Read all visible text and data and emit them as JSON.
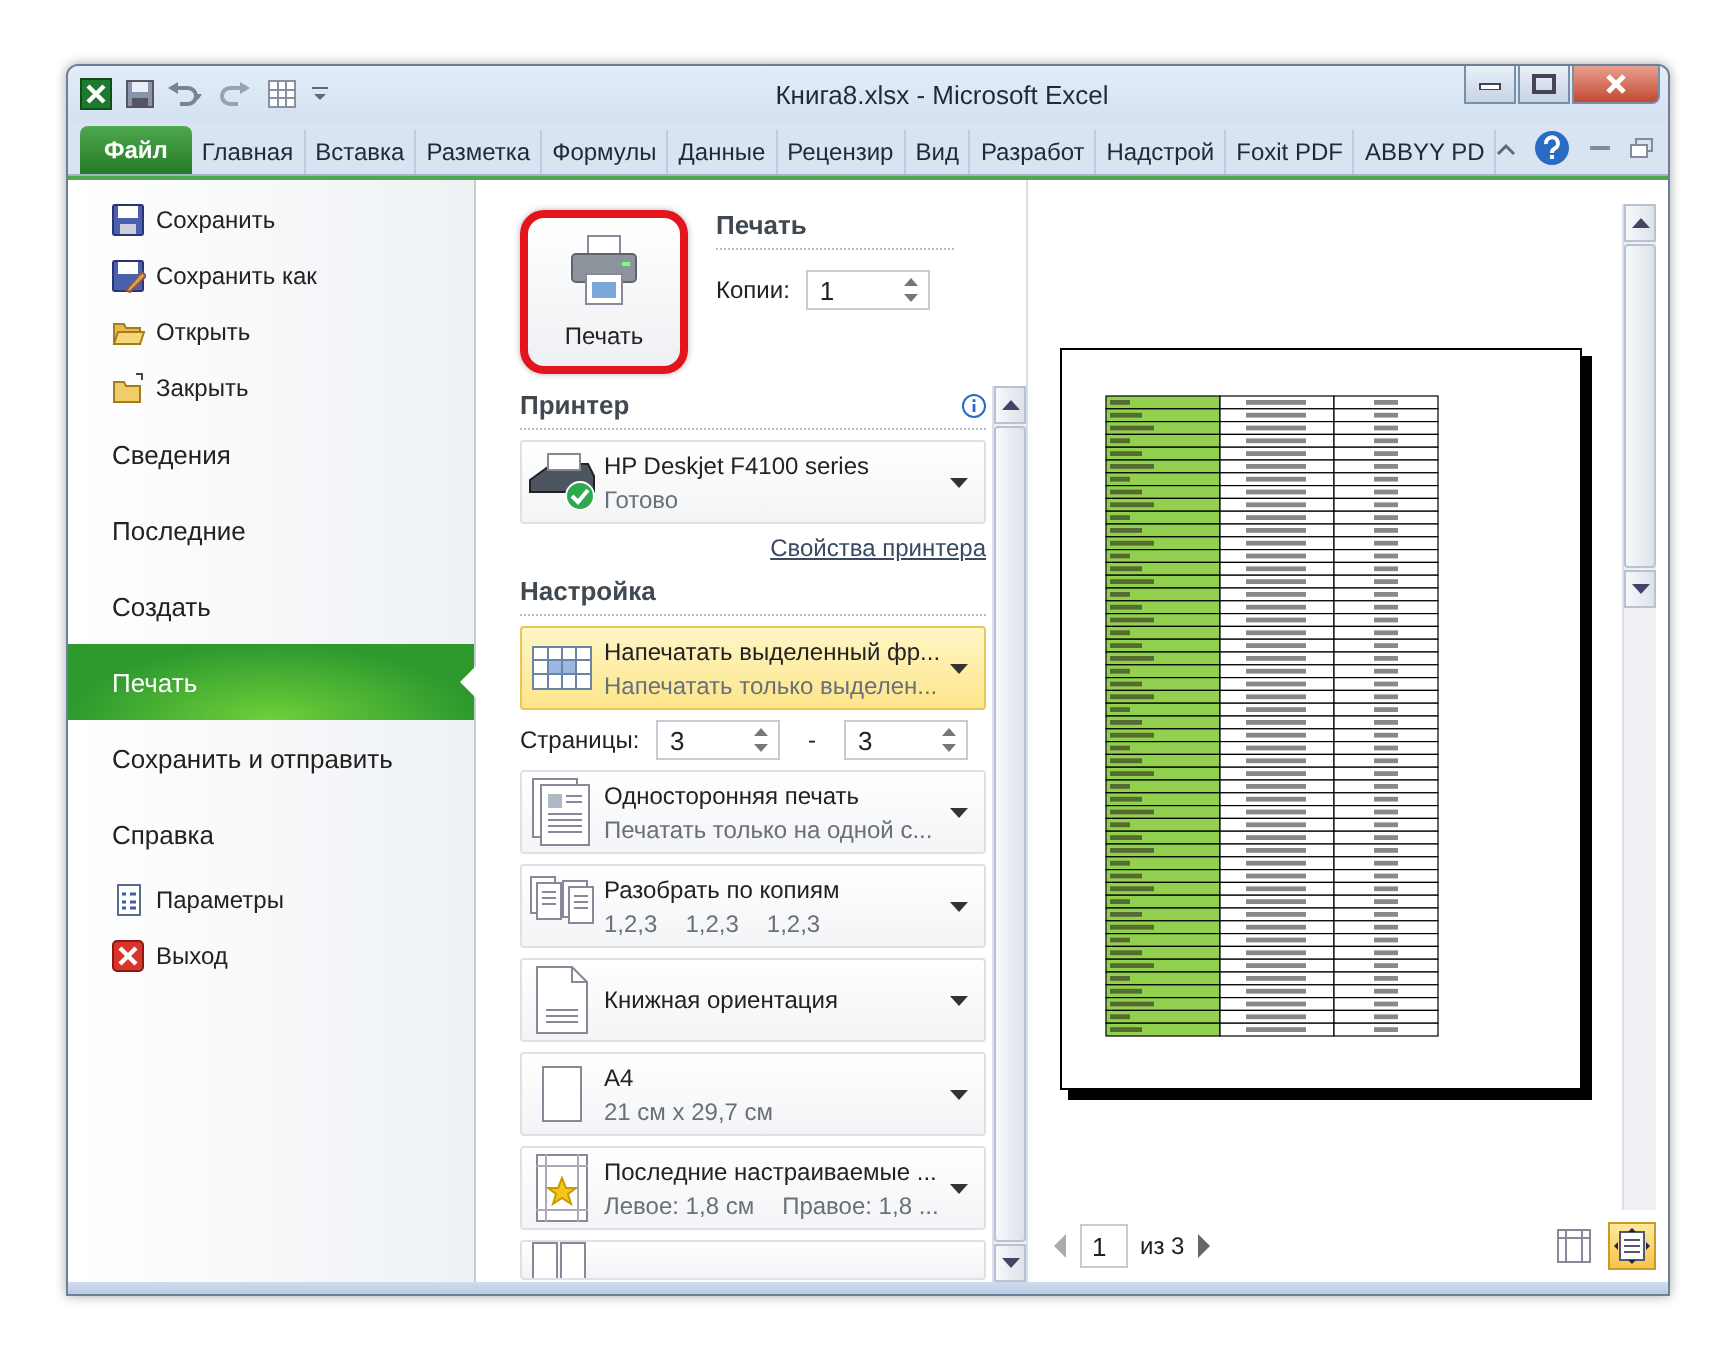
{
  "window": {
    "title": "Книга8.xlsx  -  Microsoft Excel"
  },
  "ribbon_tabs": [
    {
      "label": "Файл",
      "selected": true
    },
    {
      "label": "Главная",
      "selected": false
    },
    {
      "label": "Вставка",
      "selected": false
    },
    {
      "label": "Разметка",
      "selected": false
    },
    {
      "label": "Формулы",
      "selected": false
    },
    {
      "label": "Данные",
      "selected": false
    },
    {
      "label": "Рецензир",
      "selected": false
    },
    {
      "label": "Вид",
      "selected": false
    },
    {
      "label": "Разработ",
      "selected": false
    },
    {
      "label": "Надстрой",
      "selected": false
    },
    {
      "label": "Foxit PDF",
      "selected": false
    },
    {
      "label": "ABBYY PD",
      "selected": false
    }
  ],
  "backstage_menu": [
    {
      "kind": "command",
      "label": "Сохранить",
      "selected": false
    },
    {
      "kind": "command",
      "label": "Сохранить как",
      "selected": false
    },
    {
      "kind": "command",
      "label": "Открыть",
      "selected": false
    },
    {
      "kind": "command",
      "label": "Закрыть",
      "selected": false
    },
    {
      "kind": "section",
      "label": "Сведения",
      "selected": false
    },
    {
      "kind": "section",
      "label": "Последние",
      "selected": false
    },
    {
      "kind": "section",
      "label": "Создать",
      "selected": false
    },
    {
      "kind": "section",
      "label": "Печать",
      "selected": true
    },
    {
      "kind": "section",
      "label": "Сохранить и отправить",
      "selected": false
    },
    {
      "kind": "section",
      "label": "Справка",
      "selected": false
    },
    {
      "kind": "command",
      "label": "Параметры",
      "selected": false
    },
    {
      "kind": "command",
      "label": "Выход",
      "selected": false
    }
  ],
  "print": {
    "button_label": "Печать",
    "heading": "Печать",
    "copies_label": "Копии:",
    "copies_value": "1"
  },
  "printer": {
    "heading": "Принтер",
    "name": "HP Deskjet F4100 series",
    "status": "Готово",
    "properties_link": "Свойства принтера"
  },
  "settings": {
    "heading": "Настройка",
    "items": [
      {
        "kind": "selection",
        "title": "Напечатать выделенный фр...",
        "subtitles": [
          "Напечатать только выделен..."
        ],
        "selected": true
      },
      {
        "kind": "pages",
        "label": "Страницы:",
        "from": "3",
        "separator": "-",
        "to": "3"
      },
      {
        "kind": "one-sided",
        "title": "Односторонняя печать",
        "subtitles": [
          "Печатать только на одной с..."
        ],
        "selected": false
      },
      {
        "kind": "collate",
        "title": "Разобрать по копиям",
        "subtitles": [
          "1,2,3",
          "1,2,3",
          "1,2,3"
        ],
        "selected": false
      },
      {
        "kind": "portrait",
        "title": "Книжная ориентация",
        "selected": false
      },
      {
        "kind": "paper",
        "title": "A4",
        "subtitles": [
          "21 см x 29,7 см"
        ],
        "selected": false
      },
      {
        "kind": "margins",
        "title": "Последние настраиваемые ...",
        "subtitles": [
          "Левое:  1,8 см",
          "Правое:  1,8 ..."
        ],
        "selected": false
      },
      {
        "kind": "partial",
        "selected": false
      }
    ]
  },
  "preview": {
    "page_value": "1",
    "page_total": "из 3",
    "zoom_to_page": true
  }
}
